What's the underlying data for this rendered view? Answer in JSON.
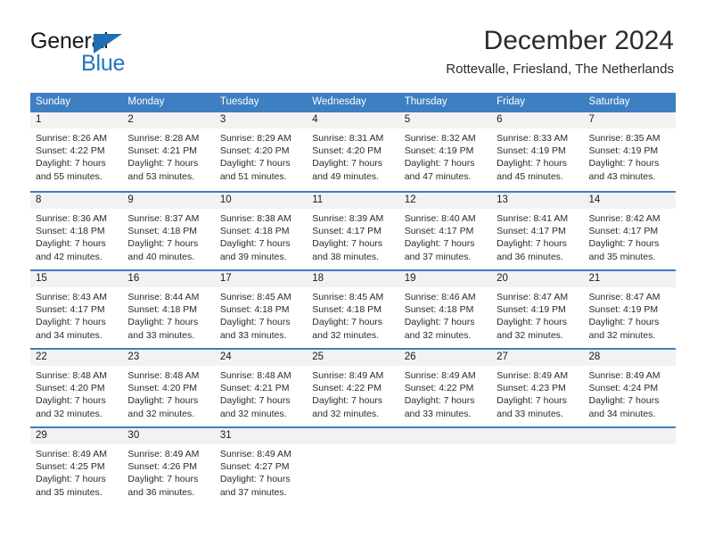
{
  "brand": {
    "name_part1": "General",
    "name_part2": "Blue",
    "triangle_color": "#1f6fb5",
    "blue_color": "#2176bd"
  },
  "header": {
    "title": "December 2024",
    "subtitle": "Rottevalle, Friesland, The Netherlands"
  },
  "theme": {
    "header_row_bg": "#3d7fc1",
    "header_row_text": "#ffffff",
    "day_band_bg": "#f2f2f2",
    "cell_bg": "#ffffff",
    "week_separator": "#3d7fc1"
  },
  "weekdays": [
    "Sunday",
    "Monday",
    "Tuesday",
    "Wednesday",
    "Thursday",
    "Friday",
    "Saturday"
  ],
  "weeks": [
    [
      {
        "day": "1",
        "line1": "Sunrise: 8:26 AM",
        "line2": "Sunset: 4:22 PM",
        "line3": "Daylight: 7 hours",
        "line4": "and 55 minutes."
      },
      {
        "day": "2",
        "line1": "Sunrise: 8:28 AM",
        "line2": "Sunset: 4:21 PM",
        "line3": "Daylight: 7 hours",
        "line4": "and 53 minutes."
      },
      {
        "day": "3",
        "line1": "Sunrise: 8:29 AM",
        "line2": "Sunset: 4:20 PM",
        "line3": "Daylight: 7 hours",
        "line4": "and 51 minutes."
      },
      {
        "day": "4",
        "line1": "Sunrise: 8:31 AM",
        "line2": "Sunset: 4:20 PM",
        "line3": "Daylight: 7 hours",
        "line4": "and 49 minutes."
      },
      {
        "day": "5",
        "line1": "Sunrise: 8:32 AM",
        "line2": "Sunset: 4:19 PM",
        "line3": "Daylight: 7 hours",
        "line4": "and 47 minutes."
      },
      {
        "day": "6",
        "line1": "Sunrise: 8:33 AM",
        "line2": "Sunset: 4:19 PM",
        "line3": "Daylight: 7 hours",
        "line4": "and 45 minutes."
      },
      {
        "day": "7",
        "line1": "Sunrise: 8:35 AM",
        "line2": "Sunset: 4:19 PM",
        "line3": "Daylight: 7 hours",
        "line4": "and 43 minutes."
      }
    ],
    [
      {
        "day": "8",
        "line1": "Sunrise: 8:36 AM",
        "line2": "Sunset: 4:18 PM",
        "line3": "Daylight: 7 hours",
        "line4": "and 42 minutes."
      },
      {
        "day": "9",
        "line1": "Sunrise: 8:37 AM",
        "line2": "Sunset: 4:18 PM",
        "line3": "Daylight: 7 hours",
        "line4": "and 40 minutes."
      },
      {
        "day": "10",
        "line1": "Sunrise: 8:38 AM",
        "line2": "Sunset: 4:18 PM",
        "line3": "Daylight: 7 hours",
        "line4": "and 39 minutes."
      },
      {
        "day": "11",
        "line1": "Sunrise: 8:39 AM",
        "line2": "Sunset: 4:17 PM",
        "line3": "Daylight: 7 hours",
        "line4": "and 38 minutes."
      },
      {
        "day": "12",
        "line1": "Sunrise: 8:40 AM",
        "line2": "Sunset: 4:17 PM",
        "line3": "Daylight: 7 hours",
        "line4": "and 37 minutes."
      },
      {
        "day": "13",
        "line1": "Sunrise: 8:41 AM",
        "line2": "Sunset: 4:17 PM",
        "line3": "Daylight: 7 hours",
        "line4": "and 36 minutes."
      },
      {
        "day": "14",
        "line1": "Sunrise: 8:42 AM",
        "line2": "Sunset: 4:17 PM",
        "line3": "Daylight: 7 hours",
        "line4": "and 35 minutes."
      }
    ],
    [
      {
        "day": "15",
        "line1": "Sunrise: 8:43 AM",
        "line2": "Sunset: 4:17 PM",
        "line3": "Daylight: 7 hours",
        "line4": "and 34 minutes."
      },
      {
        "day": "16",
        "line1": "Sunrise: 8:44 AM",
        "line2": "Sunset: 4:18 PM",
        "line3": "Daylight: 7 hours",
        "line4": "and 33 minutes."
      },
      {
        "day": "17",
        "line1": "Sunrise: 8:45 AM",
        "line2": "Sunset: 4:18 PM",
        "line3": "Daylight: 7 hours",
        "line4": "and 33 minutes."
      },
      {
        "day": "18",
        "line1": "Sunrise: 8:45 AM",
        "line2": "Sunset: 4:18 PM",
        "line3": "Daylight: 7 hours",
        "line4": "and 32 minutes."
      },
      {
        "day": "19",
        "line1": "Sunrise: 8:46 AM",
        "line2": "Sunset: 4:18 PM",
        "line3": "Daylight: 7 hours",
        "line4": "and 32 minutes."
      },
      {
        "day": "20",
        "line1": "Sunrise: 8:47 AM",
        "line2": "Sunset: 4:19 PM",
        "line3": "Daylight: 7 hours",
        "line4": "and 32 minutes."
      },
      {
        "day": "21",
        "line1": "Sunrise: 8:47 AM",
        "line2": "Sunset: 4:19 PM",
        "line3": "Daylight: 7 hours",
        "line4": "and 32 minutes."
      }
    ],
    [
      {
        "day": "22",
        "line1": "Sunrise: 8:48 AM",
        "line2": "Sunset: 4:20 PM",
        "line3": "Daylight: 7 hours",
        "line4": "and 32 minutes."
      },
      {
        "day": "23",
        "line1": "Sunrise: 8:48 AM",
        "line2": "Sunset: 4:20 PM",
        "line3": "Daylight: 7 hours",
        "line4": "and 32 minutes."
      },
      {
        "day": "24",
        "line1": "Sunrise: 8:48 AM",
        "line2": "Sunset: 4:21 PM",
        "line3": "Daylight: 7 hours",
        "line4": "and 32 minutes."
      },
      {
        "day": "25",
        "line1": "Sunrise: 8:49 AM",
        "line2": "Sunset: 4:22 PM",
        "line3": "Daylight: 7 hours",
        "line4": "and 32 minutes."
      },
      {
        "day": "26",
        "line1": "Sunrise: 8:49 AM",
        "line2": "Sunset: 4:22 PM",
        "line3": "Daylight: 7 hours",
        "line4": "and 33 minutes."
      },
      {
        "day": "27",
        "line1": "Sunrise: 8:49 AM",
        "line2": "Sunset: 4:23 PM",
        "line3": "Daylight: 7 hours",
        "line4": "and 33 minutes."
      },
      {
        "day": "28",
        "line1": "Sunrise: 8:49 AM",
        "line2": "Sunset: 4:24 PM",
        "line3": "Daylight: 7 hours",
        "line4": "and 34 minutes."
      }
    ],
    [
      {
        "day": "29",
        "line1": "Sunrise: 8:49 AM",
        "line2": "Sunset: 4:25 PM",
        "line3": "Daylight: 7 hours",
        "line4": "and 35 minutes."
      },
      {
        "day": "30",
        "line1": "Sunrise: 8:49 AM",
        "line2": "Sunset: 4:26 PM",
        "line3": "Daylight: 7 hours",
        "line4": "and 36 minutes."
      },
      {
        "day": "31",
        "line1": "Sunrise: 8:49 AM",
        "line2": "Sunset: 4:27 PM",
        "line3": "Daylight: 7 hours",
        "line4": "and 37 minutes."
      },
      {
        "day": "",
        "line1": "",
        "line2": "",
        "line3": "",
        "line4": ""
      },
      {
        "day": "",
        "line1": "",
        "line2": "",
        "line3": "",
        "line4": ""
      },
      {
        "day": "",
        "line1": "",
        "line2": "",
        "line3": "",
        "line4": ""
      },
      {
        "day": "",
        "line1": "",
        "line2": "",
        "line3": "",
        "line4": ""
      }
    ]
  ]
}
